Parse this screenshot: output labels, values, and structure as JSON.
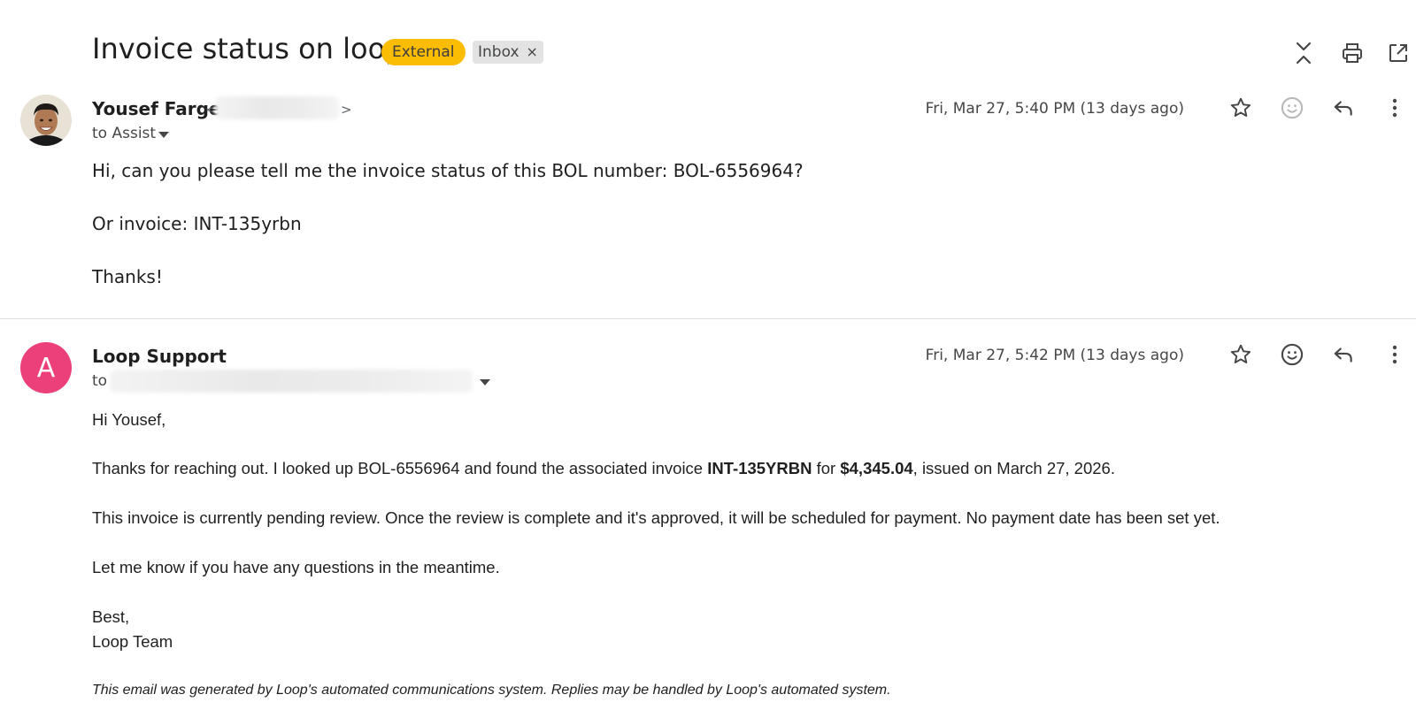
{
  "thread": {
    "subject": "Invoice status on loop",
    "labels": {
      "external": "External",
      "inbox": "Inbox",
      "remove_symbol": "×"
    },
    "colors": {
      "external_label_bg": "#fbbc04",
      "inbox_label_bg": "#e3e3e3",
      "support_avatar_bg": "#ec407a"
    },
    "header_icons": [
      "collapse-all-icon",
      "print-icon",
      "open-in-new-window-icon"
    ]
  },
  "messages": [
    {
      "sender": "Yousef Farge",
      "email_open": "<",
      "email_close": ">",
      "to_text": "to Assist",
      "timestamp": "Fri, Mar 27, 5:40 PM (13 days ago)",
      "icons": [
        "star-icon",
        "emoji-icon",
        "reply-icon",
        "more-vert-icon"
      ],
      "body": [
        "Hi, can you please tell me the invoice status of this BOL number: BOL-6556964?",
        "Or invoice: INT-135yrbn",
        "Thanks!"
      ]
    },
    {
      "sender": "Loop Support",
      "avatar_letter": "A",
      "to_text": "to",
      "timestamp": "Fri, Mar 27, 5:42 PM (13 days ago)",
      "icons": [
        "star-icon",
        "emoji-icon",
        "reply-icon",
        "more-vert-icon"
      ],
      "body": {
        "greeting": "Hi Yousef,",
        "p1_a": "Thanks for reaching out. I looked up BOL-6556964 and found the associated invoice ",
        "p1_invoice": "INT-135YRBN",
        "p1_b": " for ",
        "p1_amount": "$4,345.04",
        "p1_c": ", issued on March 27, 2026.",
        "p2": "This invoice is currently pending review. Once the review is complete and it's approved, it will be scheduled for payment. No payment date has been set yet.",
        "p3": "Let me know if you have any questions in the meantime.",
        "closing": "Best,",
        "signature": "Loop Team",
        "footer": "This email was generated by Loop's automated communications system. Replies may be handled by Loop's automated system."
      }
    }
  ]
}
